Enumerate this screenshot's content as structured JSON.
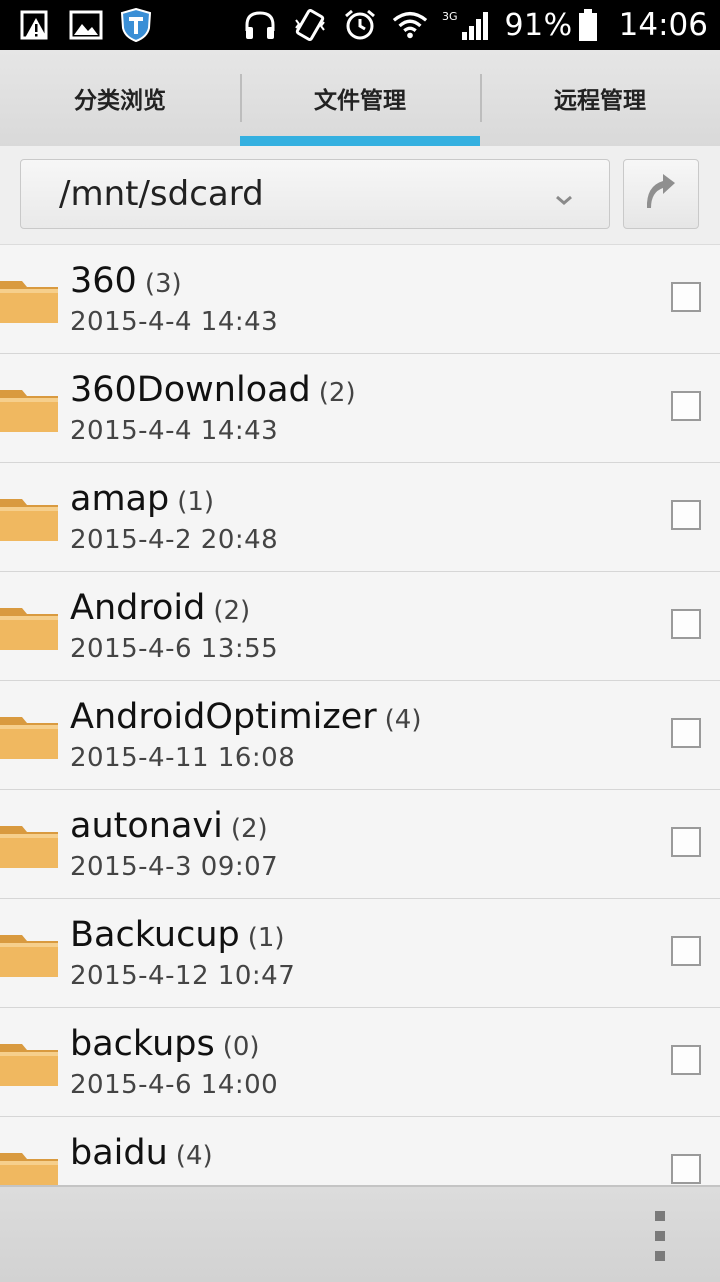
{
  "status_bar": {
    "battery_percent": "91%",
    "time": "14:06",
    "network": "3G",
    "icons": [
      "warning-icon",
      "image-icon",
      "shield-icon",
      "headset-icon",
      "vibrate-icon",
      "alarm-icon",
      "wifi-icon",
      "signal-icon",
      "battery-icon"
    ]
  },
  "tabs": [
    {
      "label": "分类浏览",
      "active": false
    },
    {
      "label": "文件管理",
      "active": true
    },
    {
      "label": "远程管理",
      "active": false
    }
  ],
  "path": {
    "value": "/mnt/sdcard"
  },
  "files": [
    {
      "name": "360",
      "count": "(3)",
      "date": "2015-4-4 14:43"
    },
    {
      "name": "360Download",
      "count": "(2)",
      "date": "2015-4-4 14:43"
    },
    {
      "name": "amap",
      "count": "(1)",
      "date": "2015-4-2 20:48"
    },
    {
      "name": "Android",
      "count": "(2)",
      "date": "2015-4-6 13:55"
    },
    {
      "name": "AndroidOptimizer",
      "count": "(4)",
      "date": "2015-4-11 16:08"
    },
    {
      "name": "autonavi",
      "count": "(2)",
      "date": "2015-4-3 09:07"
    },
    {
      "name": "Backucup",
      "count": "(1)",
      "date": "2015-4-12 10:47"
    },
    {
      "name": "backups",
      "count": "(0)",
      "date": "2015-4-6 14:00"
    },
    {
      "name": "baidu",
      "count": "(4)",
      "date": ""
    }
  ],
  "colors": {
    "tab_indicator": "#34b0e0",
    "folder": "#e9b35f"
  }
}
